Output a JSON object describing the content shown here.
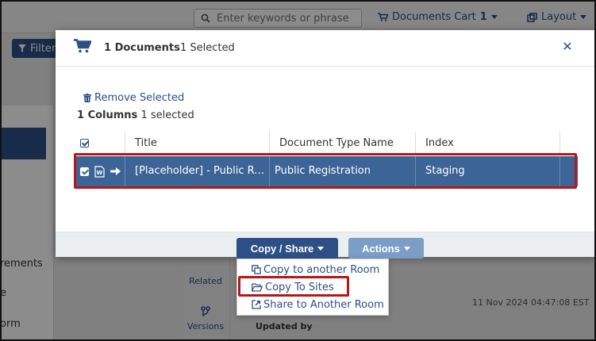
{
  "background": {
    "search_placeholder": "Enter keywords or phrase",
    "cart_label": "Documents Cart",
    "cart_count": "1",
    "layout_label": "Layout",
    "filter_label": "Filter",
    "sidebar_items": [
      "rements",
      "e",
      "orm"
    ],
    "rail_items": [
      "Related",
      "Versions"
    ],
    "timestamp": "11 Nov 2024 04:47:08 EST",
    "updated_by_label": "Updated by"
  },
  "modal": {
    "header": {
      "documents_count": "1 Documents",
      "selected_count": "1 Selected"
    },
    "remove_selected_label": "Remove Selected",
    "columns_count": "1 Columns",
    "columns_selected": "1 selected",
    "table": {
      "headers": [
        "Title",
        "Document Type Name",
        "Index"
      ],
      "rows": [
        {
          "title": "[Placeholder] - Public Registration",
          "document_type": "Public Registration",
          "index": "Staging"
        }
      ]
    }
  },
  "footer": {
    "copy_share_label": "Copy / Share",
    "actions_label": "Actions"
  },
  "dropdown": {
    "items": [
      {
        "label": "Copy to another Room",
        "icon": "copy-icon"
      },
      {
        "label": "Copy To Sites",
        "icon": "folder-open-icon"
      },
      {
        "label": "Share to Another Room",
        "icon": "share-icon"
      }
    ]
  },
  "colors": {
    "primary": "#2c4f85",
    "row_selected": "#3d6496",
    "highlight": "#b81616",
    "actions_button": "#7a9ec6"
  }
}
